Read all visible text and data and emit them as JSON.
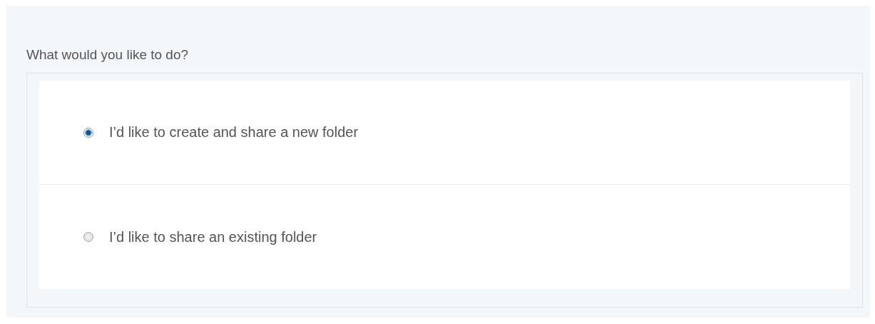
{
  "question": "What would you like to do?",
  "options": [
    {
      "label": "I’d like to create and share a new folder",
      "selected": true
    },
    {
      "label": "I’d like to share an existing folder",
      "selected": false
    }
  ]
}
